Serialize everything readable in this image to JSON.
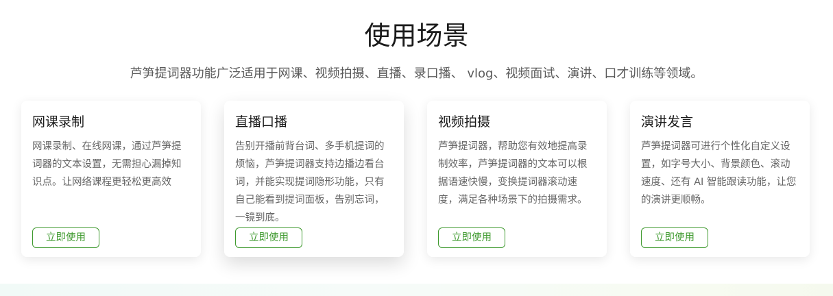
{
  "section": {
    "title": "使用场景",
    "subtitle": "芦笋提词器功能广泛适用于网课、视频拍摄、直播、录口播、 vlog、视频面试、演讲、口才训练等领域。"
  },
  "cards": [
    {
      "title": "网课录制",
      "description": "网课录制、在线网课，通过芦笋提词器的文本设置，无需担心漏掉知识点。让网络课程更轻松更高效",
      "button_label": "立即使用"
    },
    {
      "title": "直播口播",
      "description": "告别开播前背台词、多手机提词的烦恼，芦笋提词器支持边播边看台词，并能实现提词隐形功能，只有自己能看到提词面板，告别忘词，一镜到底。",
      "button_label": "立即使用"
    },
    {
      "title": "视频拍摄",
      "description": "芦笋提词器，帮助您有效地提高录制效率，芦笋提词器的文本可以根据语速快慢，变换提词器滚动速度，满足各种场景下的拍摄需求。",
      "button_label": "立即使用"
    },
    {
      "title": "演讲发言",
      "description": "芦笋提词器可进行个性化自定义设置，如字号大小、背景颜色、滚动速度、还有 AI 智能跟读功能，让您的演讲更顺畅。",
      "button_label": "立即使用"
    }
  ],
  "colors": {
    "accent": "#3f9a2f",
    "title_text": "#1a1a1a",
    "body_text": "#666666"
  }
}
